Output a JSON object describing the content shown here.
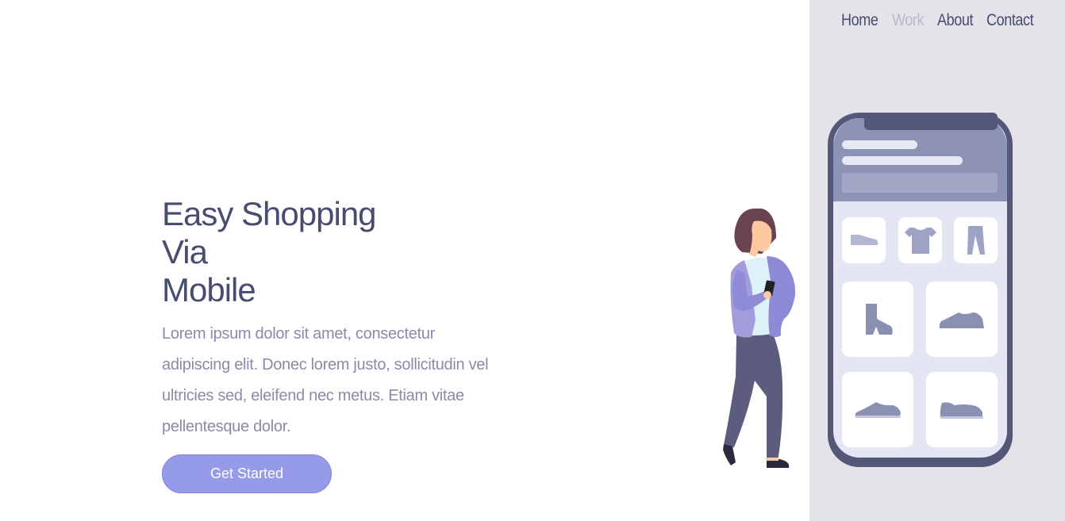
{
  "nav": {
    "items": [
      {
        "label": "Home",
        "active": false
      },
      {
        "label": "Work",
        "active": true
      },
      {
        "label": "About",
        "active": false
      },
      {
        "label": "Contact",
        "active": false
      }
    ]
  },
  "hero": {
    "title_line1": "Easy Shopping Via",
    "title_line2": "Mobile",
    "description": "Lorem ipsum dolor sit amet, consectetur adipiscing elit. Donec lorem justo, sollicitudin vel ultricies sed, eleifend nec metus. Etiam vitae pellentesque dolor.",
    "cta_label": "Get Started"
  },
  "colors": {
    "primary_text": "#474c70",
    "muted_text": "#8c8aa6",
    "accent": "#959be9",
    "panel_bg": "#e4e3ea"
  },
  "icons": [
    "shoe-icon",
    "tshirt-icon",
    "pants-icon",
    "boot-icon",
    "sneaker-icon"
  ]
}
